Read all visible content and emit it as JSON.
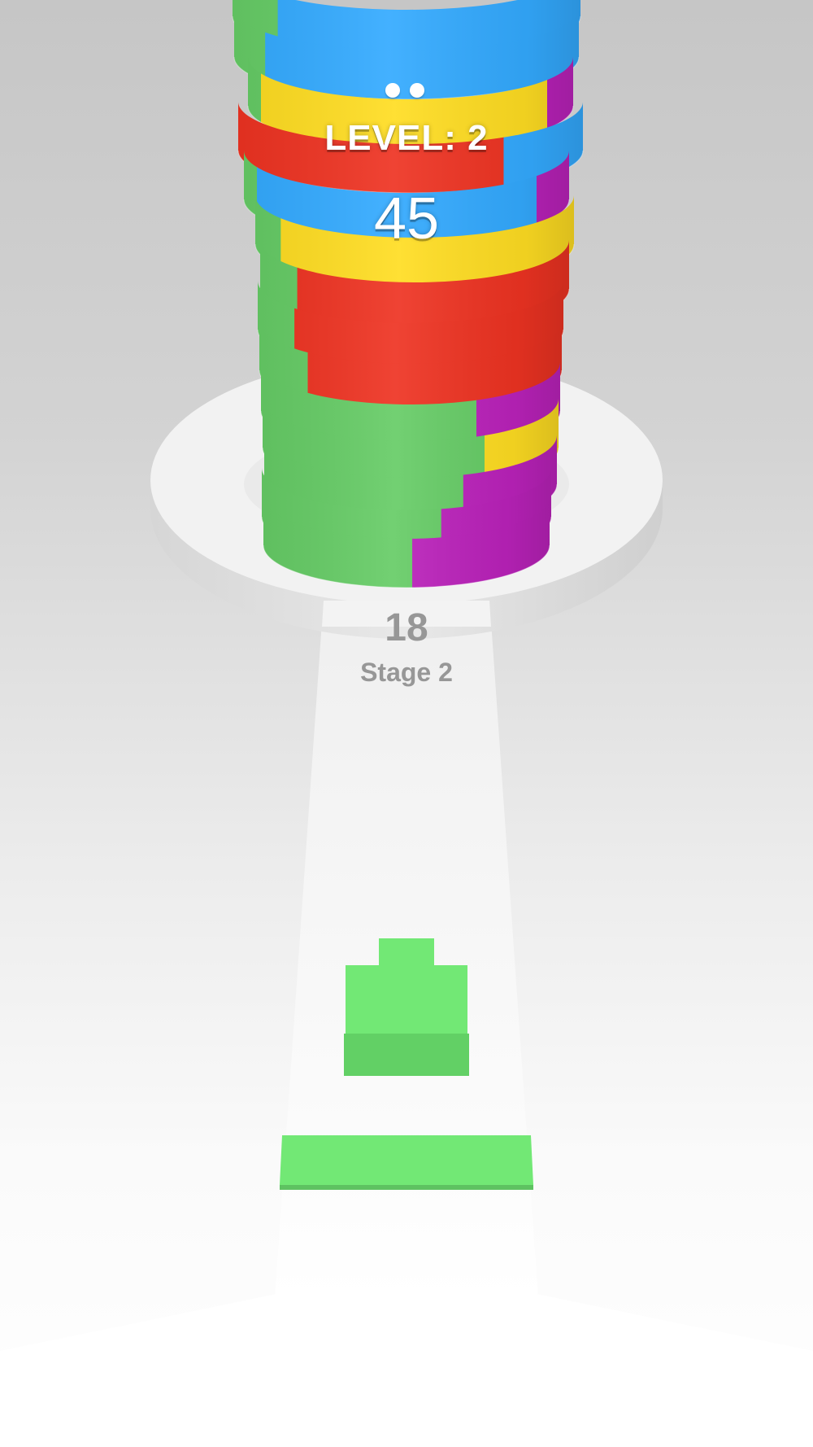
{
  "hud": {
    "level_text": "LEVEL: 2",
    "score": "45",
    "progress_dots": 2
  },
  "path": {
    "remaining_count": "18",
    "stage_text": "Stage 2"
  },
  "colors": {
    "green": "#66cc66",
    "blue": "#33aaff",
    "yellow": "#ffdd22",
    "red": "#ee3322",
    "purple": "#bb22bb",
    "player_green": "#72e875",
    "platform": "#f2f2f2",
    "path": "#f7f7f7"
  },
  "tower": {
    "ring_count": 16
  }
}
